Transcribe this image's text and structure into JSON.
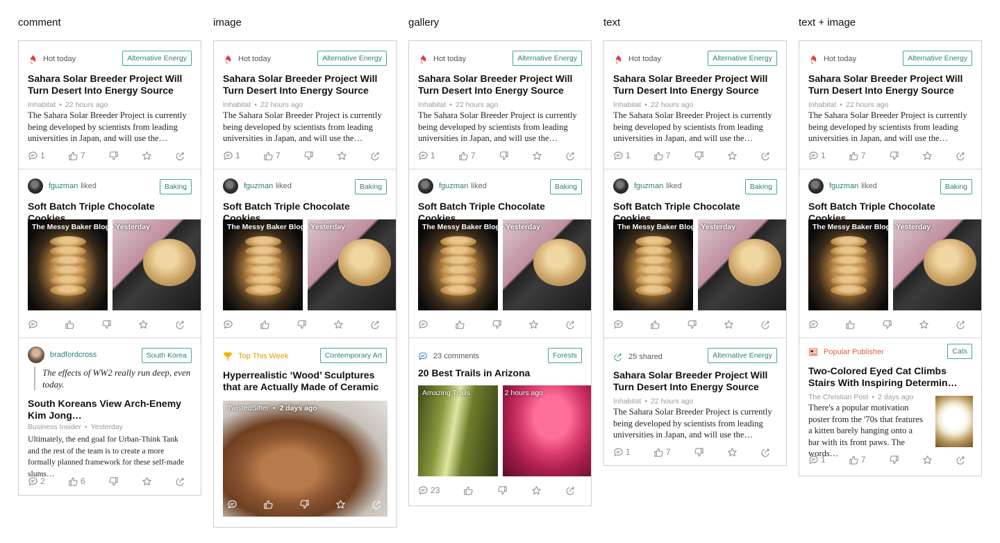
{
  "columns": [
    {
      "label": "comment"
    },
    {
      "label": "image"
    },
    {
      "label": "gallery"
    },
    {
      "label": "text"
    },
    {
      "label": "text + image"
    }
  ],
  "hot_card": {
    "badge": "Hot today",
    "tag": "Alternative Energy",
    "title": "Sahara Solar Breeder Project Will Turn Desert Into Energy Source",
    "source": "Inhabitat",
    "time": "22 hours ago",
    "snippet": "The Sahara Solar Breeder Project is currently being developed by scientists from leading universities in Japan, and will use the…",
    "comments": "1",
    "likes": "7"
  },
  "liked_card": {
    "user": "fguzman",
    "action": "liked",
    "tag": "Baking",
    "title": "Soft Batch Triple Chocolate Cookies",
    "photo_source": "The Messy Baker Blog",
    "photo_time": "Yesterday"
  },
  "comment_card": {
    "user": "bradfordcross",
    "tag": "South Korea",
    "quote": "The effects of WW2 really run deep, even today.",
    "title": "South Koreans View Arch-Enemy Kim Jong…",
    "source": "Business Insider",
    "time": "Yesterday",
    "snippet": "Ultimately, the end goal for Urban-Think Tank and the rest of the team is to create a more formally planned framework for these self-made slums…",
    "comments": "2",
    "likes": "6"
  },
  "image_card": {
    "badge": "Top This Week",
    "tag": "Contemporary Art",
    "title": "Hyperrealistic ‘Wood’ Sculptures that are Actually Made of Ceramic",
    "photo_source": "TwistedSifter",
    "photo_time": "2 days ago"
  },
  "gallery_card": {
    "badge": "23 comments",
    "tag": "Forests",
    "title": "20 Best Trails in Arizona",
    "photo_source": "Amazing Trails",
    "photo_time": "2 hours ago",
    "comments": "23"
  },
  "text_card": {
    "badge": "25 shared",
    "tag": "Alternative Energy",
    "title": "Sahara Solar Breeder Project Will Turn Desert Into Energy Source",
    "source": "Inhabitat",
    "time": "22 hours ago",
    "snippet": "The Sahara Solar Breeder Project is currently being developed by scientists from leading universities in Japan, and will use the…",
    "comments": "1",
    "likes": "7"
  },
  "textimage_card": {
    "badge": "Popular Publisher",
    "tag": "Cats",
    "title": "Two-Colored Eyed Cat Climbs Stairs With Inspiring Determin…",
    "source": "The Christian Post",
    "time": "2 days ago",
    "snippet": "There's a popular motivation poster from the '70s that features a kitten barely hanging onto a bar with its front paws. The words…",
    "comments": "1",
    "likes": "7"
  },
  "colors": {
    "tag_border": "#3ea5a1",
    "tag_text": "#2c7e7b",
    "hot_icon": "#e53935",
    "trophy_icon": "#f0b400",
    "publisher_icon": "#e0603a",
    "share_icon": "#2c8f8a",
    "comment_icon": "#2a6ebb"
  }
}
